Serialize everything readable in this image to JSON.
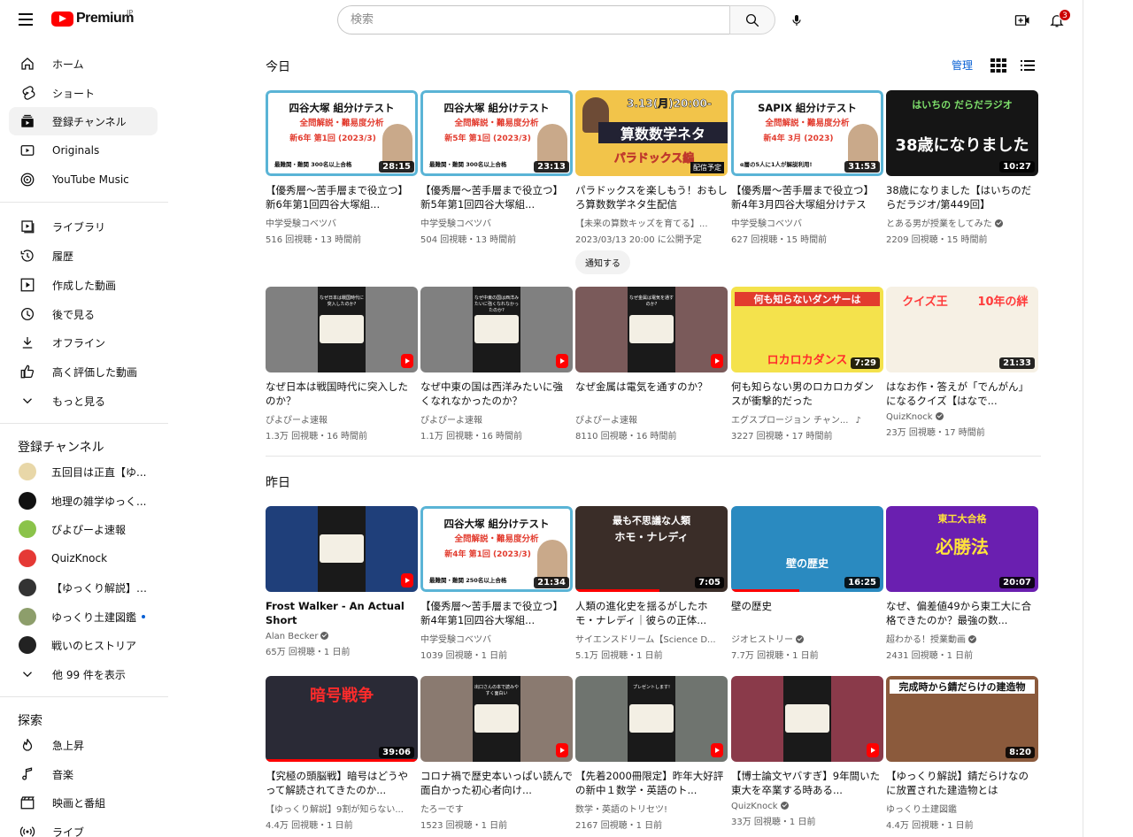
{
  "header": {
    "logo_text": "Premium",
    "logo_region": "JP",
    "search_placeholder": "検索",
    "notification_count": "3"
  },
  "sidebar": {
    "main": [
      {
        "label": "ホーム",
        "icon": "home-icon"
      },
      {
        "label": "ショート",
        "icon": "shorts-icon"
      },
      {
        "label": "登録チャンネル",
        "icon": "subscriptions-icon",
        "active": true
      },
      {
        "label": "Originals",
        "icon": "originals-icon"
      },
      {
        "label": "YouTube Music",
        "icon": "youtube-music-icon"
      }
    ],
    "library": [
      {
        "label": "ライブラリ",
        "icon": "library-icon"
      },
      {
        "label": "履歴",
        "icon": "history-icon"
      },
      {
        "label": "作成した動画",
        "icon": "your-videos-icon"
      },
      {
        "label": "後で見る",
        "icon": "watch-later-icon"
      },
      {
        "label": "オフライン",
        "icon": "download-icon"
      },
      {
        "label": "高く評価した動画",
        "icon": "liked-icon"
      },
      {
        "label": "もっと見る",
        "icon": "chevron-down-icon"
      }
    ],
    "subscriptions_heading": "登録チャンネル",
    "subscriptions": [
      {
        "label": "五回目は正直【ゆ...",
        "color": "#e8d7a8"
      },
      {
        "label": "地理の雑学ゆっく...",
        "color": "#111111"
      },
      {
        "label": "ぴよぴーよ速報",
        "color": "#8bc34a"
      },
      {
        "label": "QuizKnock",
        "color": "#e53935"
      },
      {
        "label": "【ゆっくり解説】9...",
        "color": "#333333"
      },
      {
        "label": "ゆっくり土建図鑑",
        "color": "#8d9e6b",
        "new": true
      },
      {
        "label": "戦いのヒストリア",
        "color": "#222222"
      },
      {
        "label": "他 99 件を表示",
        "icon": "chevron-down-icon"
      }
    ],
    "explore_heading": "探索",
    "explore": [
      {
        "label": "急上昇",
        "icon": "trending-icon"
      },
      {
        "label": "音楽",
        "icon": "music-icon"
      },
      {
        "label": "映画と番組",
        "icon": "movies-icon"
      },
      {
        "label": "ライブ",
        "icon": "live-icon"
      }
    ]
  },
  "main": {
    "manage_label": "管理",
    "sections": [
      {
        "title": "今日",
        "rows": [
          [
            {
              "title": "【優秀層〜苦手層まで役立つ】新6年第1回四谷大塚組...",
              "channel": "中学受験コベツバ",
              "meta": "516 回視聴・13 時間前",
              "duration": "28:15",
              "thumb_title": "四谷大塚 組分けテスト",
              "thumb_sub": "全問解説・難易度分析",
              "thumb_big": "新6年 第1回 (2023/3)",
              "thumb_foot": "最難関・難関 300名以上合格"
            },
            {
              "title": "【優秀層〜苦手層まで役立つ】新5年第1回四谷大塚組...",
              "channel": "中学受験コベツバ",
              "meta": "504 回視聴・13 時間前",
              "duration": "23:13",
              "thumb_title": "四谷大塚 組分けテスト",
              "thumb_sub": "全問解説・難易度分析",
              "thumb_big": "新5年 第1回 (2023/3)",
              "thumb_foot": "最難関・難関 300名以上合格"
            },
            {
              "title": "パラドックスを楽しもう！おもしろ算数数学ネタ生配信",
              "channel": "【未来の算数キッズを育てる】...",
              "meta": "2023/03/13 20:00 に公開予定",
              "notify": "通知する",
              "thumb_date": "3.13(月)20:00-",
              "thumb_big": "算数数学ネタ",
              "thumb_foot": "パラドックス編",
              "thumb_badge": "配信予定"
            },
            {
              "title": "【優秀層〜苦手層まで役立つ】新4年3月四谷大塚組分けテスト...",
              "channel": "中学受験コベツバ",
              "meta": "627 回視聴・15 時間前",
              "duration": "31:53",
              "thumb_title": "SAPIX 組分けテスト",
              "thumb_sub": "全問解説・難易度分析",
              "thumb_big": "新4年 3月 (2023)",
              "thumb_foot": "α層の5人に1人が解説利用!"
            },
            {
              "title": "38歳になりました【はいちのだらだラジオ/第449回】",
              "channel": "とある男が授業をしてみた",
              "meta": "2209 回視聴・15 時間前",
              "duration": "10:27",
              "verified": true,
              "thumb_title": "はいちの だらだラジオ",
              "thumb_big": "38歳になりました"
            }
          ],
          [
            {
              "title": "なぜ日本は戦国時代に突入したのか？",
              "channel": "ぴよぴーよ速報",
              "meta": "1.3万 回視聴・16 時間前",
              "short": true,
              "short_color": "#808080",
              "thumb_caption": "なぜ日本は戦国時代に突入したのか?"
            },
            {
              "title": "なぜ中東の国は西洋みたいに強くなれなかったのか？",
              "channel": "ぴよぴーよ速報",
              "meta": "1.1万 回視聴・16 時間前",
              "short": true,
              "short_color": "#808080",
              "thumb_caption": "なぜ中東の国は西洋みたいに強くなれなかったのか?"
            },
            {
              "title": "なぜ金属は電気を通すのか？",
              "channel": "ぴよぴーよ速報",
              "meta": "8110 回視聴・16 時間前",
              "short": true,
              "short_color": "#7a5a5a",
              "thumb_caption": "なぜ金属は電気を通すのか?"
            },
            {
              "title": "何も知らない男のロカロカダンスが衝撃的だった",
              "channel": "エグスプロージョン チャン...",
              "meta": "3227 回視聴・17 時間前",
              "duration": "7:29",
              "music": true,
              "thumb_title": "何も知らないダンサーは",
              "thumb_big": "ロカロカダンス"
            },
            {
              "title": "はなお作・答えが「でんがん」になるクイズ【はなで...",
              "channel": "QuizKnock",
              "meta": "23万 回視聴・17 時間前",
              "duration": "21:33",
              "verified": true,
              "thumb_title": "クイズ王",
              "thumb_big": "10年の絆"
            }
          ]
        ]
      },
      {
        "title": "昨日",
        "rows": [
          [
            {
              "title": "Frost Walker - An Actual Short",
              "channel": "Alan Becker",
              "meta": "65万 回視聴・1 日前",
              "short": true,
              "bold": true,
              "verified": true,
              "short_color": "#1f3f7a"
            },
            {
              "title": "【優秀層〜苦手層まで役立つ】新4年第1回四谷大塚組...",
              "channel": "中学受験コベツバ",
              "meta": "1039 回視聴・1 日前",
              "duration": "21:34",
              "thumb_title": "四谷大塚 組分けテスト",
              "thumb_sub": "全問解説・難易度分析",
              "thumb_big": "新4年 第1回 (2023/3)",
              "thumb_foot": "最難関・難関 250名以上合格"
            },
            {
              "title": "人類の進化史を揺るがしたホモ・ナレディ｜彼らの正体...",
              "channel": "サイエンスドリーム【Science D...",
              "meta": "5.1万 回視聴・1 日前",
              "duration": "7:05",
              "progress": 0.55,
              "thumb_title": "最も不思議な人類",
              "thumb_big": "ホモ・ナレディ"
            },
            {
              "title": "壁の歴史",
              "channel": "ジオヒストリー",
              "meta": "7.7万 回視聴・1 日前",
              "duration": "16:25",
              "verified": true,
              "progress": 0.45,
              "thumb_big": "壁の歴史"
            },
            {
              "title": "なぜ、偏差値49から東工大に合格できたのか？最強の数...",
              "channel": "超わかる！授業動画",
              "meta": "2431 回視聴・1 日前",
              "duration": "20:07",
              "verified": true,
              "thumb_title": "東工大合格",
              "thumb_big": "必勝法"
            }
          ],
          [
            {
              "title": "【究極の頭脳戦】暗号はどうやって解読されてきたのか...",
              "channel": "【ゆっくり解説】9割が知らない...",
              "meta": "4.4万 回視聴・1 日前",
              "duration": "39:06",
              "progress": 1.0,
              "thumb_big": "暗号戦争"
            },
            {
              "title": "コロナ禍で歴史本いっぱい読んで面白かった初心者向け...",
              "channel": "たろーです",
              "meta": "1523 回視聴・1 日前",
              "short": true,
              "short_color": "#8a7a70",
              "thumb_caption": "出口さんの本で読みやすく面白い"
            },
            {
              "title": "【先着2000冊限定】昨年大好評の新中１数学・英語のト...",
              "channel": "数学・英語のトリセツ!",
              "meta": "2167 回視聴・1 日前",
              "short": true,
              "short_color": "#6f746f",
              "thumb_caption": "プレゼントします!"
            },
            {
              "title": "【博士論文ヤバすぎ】9年間いた東大を卒業する時ある...",
              "channel": "QuizKnock",
              "meta": "33万 回視聴・1 日前",
              "short": true,
              "verified": true,
              "short_color": "#8a3a4a",
              "thumb_caption": ""
            },
            {
              "title": "【ゆっくり解説】錆だらけなのに放置された建造物とは",
              "channel": "ゆっくり土建図鑑",
              "meta": "4.4万 回視聴・1 日前",
              "duration": "8:20",
              "thumb_title": "完成時から錆だらけの建造物"
            }
          ]
        ]
      }
    ]
  },
  "colors": {
    "brand_red": "#ff0000",
    "link_blue": "#065fd4",
    "text_secondary": "#606060"
  }
}
